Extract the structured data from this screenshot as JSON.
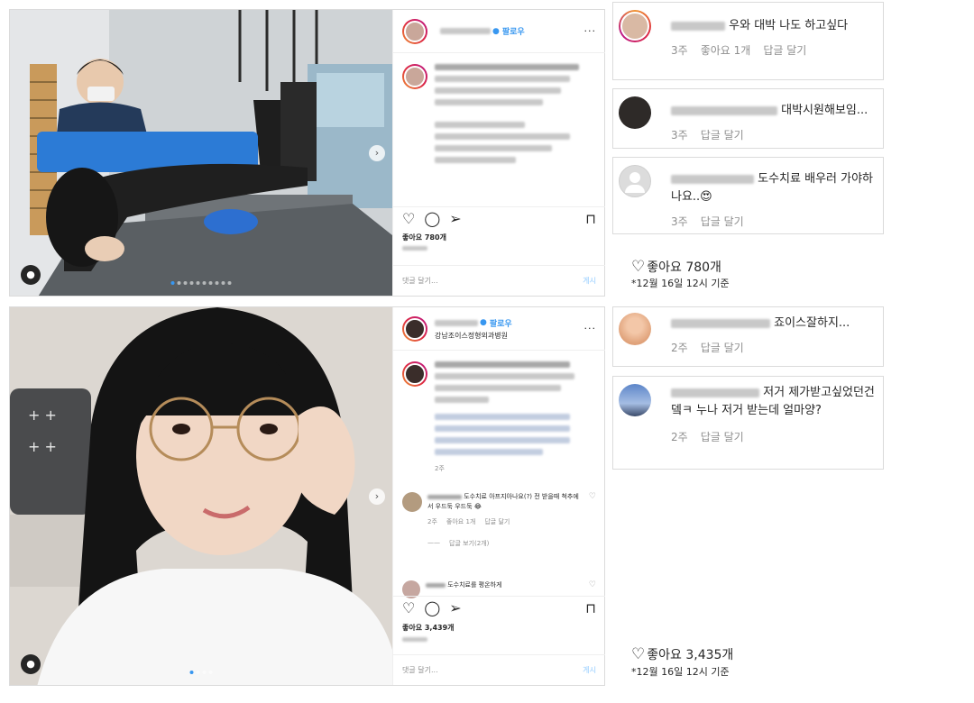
{
  "post1": {
    "header": {
      "follow": "팔로우",
      "more": "···"
    },
    "likes": "좋아요 780개",
    "comment_placeholder": "댓글 달기...",
    "post_button": "게시"
  },
  "post2": {
    "header": {
      "follow": "팔로우",
      "location": "강남조이스정형외과병원",
      "more": "···"
    },
    "caption_time": "2주",
    "reply1": {
      "text": "도수치료 아프지아나요(?) 전 받을때 척추에서 우드둑 우드둑 😂",
      "time": "2주",
      "likes": "좋아요 1개",
      "reply": "답글 달기"
    },
    "view_replies": "답글 보기(2개)",
    "reply2_text": "도수치료를 평온하게",
    "likes": "좋아요 3,439개",
    "comment_placeholder": "댓글 달기...",
    "post_button": "게시"
  },
  "right_cards": [
    {
      "text": "우와 대박 나도 하고싶다",
      "time": "3주",
      "likes": "좋아요 1개",
      "reply": "답글 달기"
    },
    {
      "text": "대박시원해보임...",
      "time": "3주",
      "reply": "답글 달기"
    },
    {
      "text": "도수치료 배우러 가야하나요..😍",
      "time": "3주",
      "reply": "답글 달기"
    },
    {
      "text": "죠이스잘하지...",
      "time": "2주",
      "reply": "답글 달기"
    },
    {
      "text": "저거 제가받고싶었던건뎈ㅋ 누나 저거 받는데 얼마양?",
      "time": "2주",
      "reply": "답글 달기"
    }
  ],
  "summary1": {
    "likes": "좋아요 780개",
    "stamp": "*12월 16일 12시 기준"
  },
  "summary2": {
    "likes": "좋아요 3,435개",
    "stamp": "*12월 16일 12시 기준"
  }
}
